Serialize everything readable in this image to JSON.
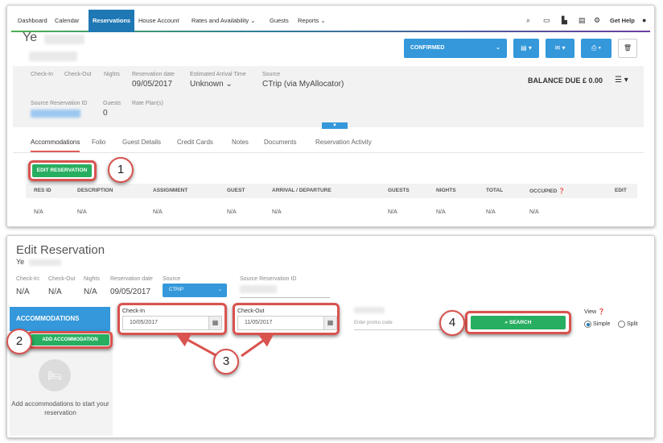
{
  "nav": {
    "items": [
      "Dashboard",
      "Calendar",
      "Reservations",
      "House Account",
      "Rates and Availability ⌄",
      "Guests",
      "Reports ⌄"
    ],
    "get_help": "Get Help"
  },
  "reservation": {
    "guest_initial": "Ye",
    "status_button": "CONFIRMED",
    "balance_due": "BALANCE DUE £ 0.00",
    "labels": {
      "check_in": "Check-In",
      "check_out": "Check-Out",
      "nights": "Nights",
      "reservation_date": "Reservation date",
      "estimated_arrival": "Estimated Arrival Time",
      "source": "Source",
      "source_reservation_id": "Source Reservation ID",
      "guests": "Guests",
      "rate_plans": "Rate Plan(s)"
    },
    "values": {
      "reservation_date": "09/05/2017",
      "estimated_arrival": "Unknown ⌄",
      "source": "CTrip (via MyAllocator)",
      "guests": "0"
    }
  },
  "tabs": [
    "Accommodations",
    "Folio",
    "Guest Details",
    "Credit Cards",
    "Notes",
    "Documents",
    "Reservation Activity"
  ],
  "edit_button": "EDIT RESERVATION",
  "table": {
    "headers": [
      "RES ID",
      "DESCRIPTION",
      "ASSIGNMENT",
      "GUEST",
      "ARRIVAL / DEPARTURE",
      "GUESTS",
      "NIGHTS",
      "TOTAL",
      "OCCUPIED ❓",
      "EDIT"
    ],
    "row": [
      "N/A",
      "N/A",
      "N/A",
      "N/A",
      "N/A",
      "N/A",
      "N/A",
      "N/A",
      "N/A"
    ]
  },
  "edit_form": {
    "title": "Edit Reservation",
    "guest_initial": "Ye",
    "labels": {
      "check_in": "Check-In:",
      "check_out": "Check-Out",
      "nights": "Nights",
      "reservation_date": "Reservation date",
      "source": "Source",
      "source_reservation_id": "Source Reservation ID"
    },
    "values": {
      "check_in": "N/A",
      "check_out": "N/A",
      "nights": "N/A",
      "reservation_date": "09/05/2017",
      "source": "CTRIP"
    },
    "sidebar_title": "ACCOMMODATIONS",
    "add_accommodation": "ADD ACCOMMODATION",
    "empty_text": "Add accommodations to start your reservation",
    "check_in_label": "Check-In",
    "check_in_value": "10/05/2017",
    "check_out_label": "Check-Out",
    "check_out_value": "11/05/2017",
    "promo_placeholder": "Enter promo code",
    "search_button": "SEARCH",
    "view_label": "View ❓",
    "view_simple": "Simple",
    "view_split": "Split",
    "view_selected": "Simple"
  },
  "annotations": [
    "1",
    "2",
    "3",
    "4"
  ],
  "colors": {
    "primary": "#3498db",
    "success": "#27ae60",
    "annotation": "#d9534f",
    "nav_active": "#1f78b4"
  }
}
